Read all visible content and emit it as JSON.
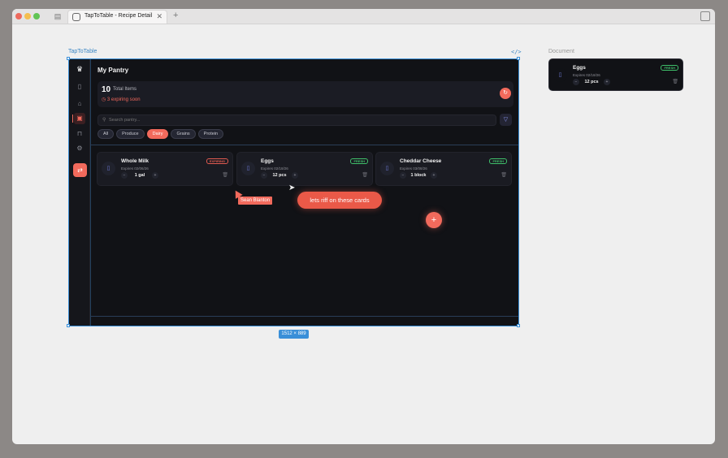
{
  "tab": {
    "title": "TapToTable - Recipe Detail"
  },
  "canvas": {
    "label": "TapToTable",
    "code_icon": "</>",
    "size": "1512 × 889",
    "document_label": "Document"
  },
  "app": {
    "header": "My Pantry",
    "stats": {
      "count": "10",
      "count_label": "Total Items",
      "expiring": "3 expiring soon"
    },
    "search_placeholder": "Search pantry...",
    "chips": [
      "All",
      "Produce",
      "Dairy",
      "Grains",
      "Protein"
    ],
    "active_chip": "Dairy",
    "cards": [
      {
        "name": "Whole Milk",
        "expires": "Expires 02/06/26",
        "badge": "EXPIRING",
        "qty": "1 gal"
      },
      {
        "name": "Eggs",
        "expires": "Expires 02/18/26",
        "badge": "FRESH",
        "qty": "12 pcs"
      },
      {
        "name": "Cheddar Cheese",
        "expires": "Expires 03/08/26",
        "badge": "FRESH",
        "qty": "1 block"
      }
    ]
  },
  "collab": {
    "user_name": "Sean Blanton",
    "comment": "lets riff on these cards"
  },
  "document_card": {
    "name": "Eggs",
    "expires": "Expires 02/18/26",
    "badge": "FRESH",
    "qty": "12 pcs"
  },
  "colors": {
    "accent": "#f26a5c",
    "fresh": "#3fbf6a",
    "expiring": "#e05a50",
    "selection": "#3a8fd8"
  }
}
